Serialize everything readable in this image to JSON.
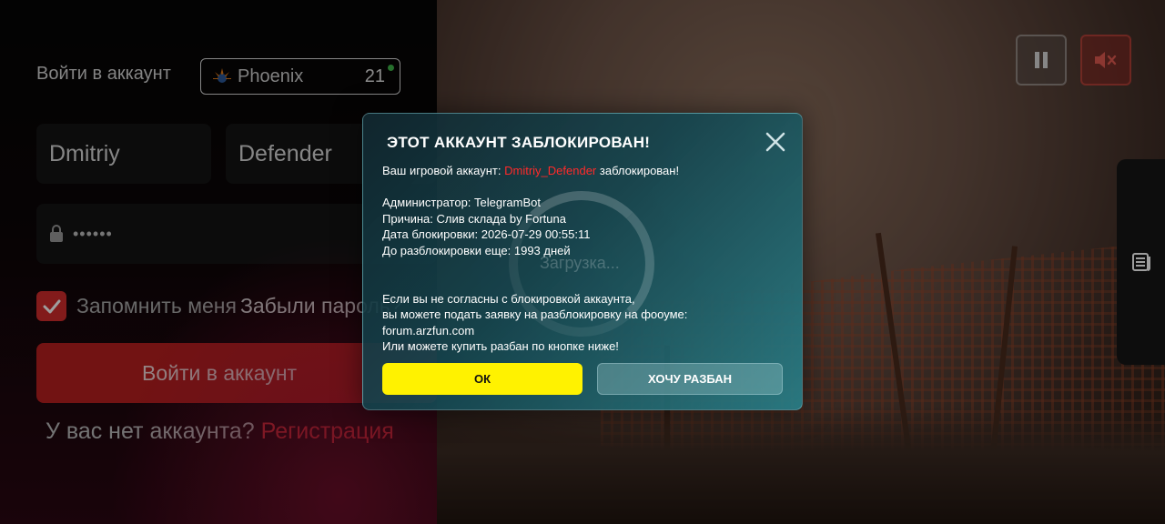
{
  "login": {
    "title": "Войти в аккаунт",
    "server_name": "Phoenix",
    "server_number": "21",
    "first_name": "Dmitriy",
    "last_name": "Defender",
    "password_mask": "••••••",
    "remember_label": "Запомнить меня",
    "forgot_label": "Забыли пароль?",
    "login_button": "Войти в аккаунт",
    "no_account_text": "У вас нет аккаунта? ",
    "register_link": "Регистрация"
  },
  "loader": {
    "text": "Загрузка..."
  },
  "modal": {
    "title": "ЭТОТ АККАУНТ ЗАБЛОКИРОВАН!",
    "line_account_prefix": "Ваш игровой аккаунт: ",
    "blocked_name": "Dmitriy_Defender",
    "line_account_suffix": " заблокирован!",
    "admin": "Администратор: TelegramBot",
    "reason": "Причина: Слив склада by Fortuna",
    "date": "Дата блокировки: 2026-07-29 00:55:11",
    "remaining": "До разблокировки еще: 1993 дней",
    "appeal_1": "Если вы не согласны с блокировкой аккаунта,",
    "appeal_2": "вы можете подать заявку на разблокировку на фооуме:",
    "appeal_3": "forum.arzfun.com",
    "appeal_4": "Или можете купить разбан по кнопке ниже!",
    "ok_button": "ОК",
    "unban_button": "ХОЧУ РАЗБАН"
  },
  "colors": {
    "accent_red": "#b81f1f",
    "ok_yellow": "#fff200",
    "blocked_name_red": "#ff2a2a"
  },
  "icons": [
    "phoenix-logo-icon",
    "lock-icon",
    "check-icon",
    "pause-icon",
    "mute-icon",
    "news-icon",
    "close-icon"
  ]
}
